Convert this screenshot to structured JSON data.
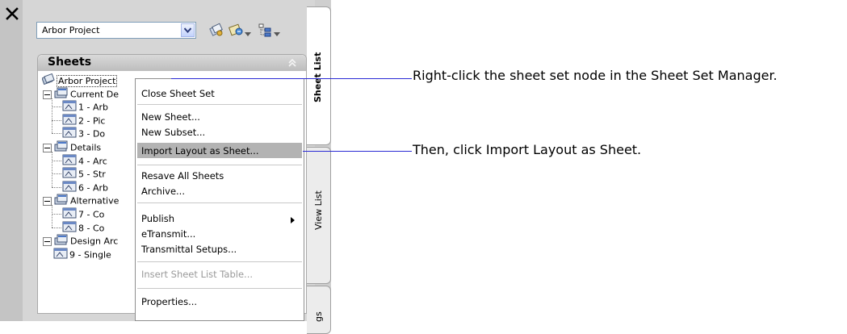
{
  "palette": {
    "close_icon": "close-icon",
    "project_selector": {
      "value": "Arbor Project"
    },
    "toolbar_icons": [
      "sheet-set-icon",
      "publish-icon",
      "view-options-icon"
    ]
  },
  "sheets_panel": {
    "title": "Sheets",
    "tree": [
      {
        "label": "Arbor Project",
        "level": 0,
        "type": "root"
      },
      {
        "label": "Current De",
        "level": 1,
        "type": "subset"
      },
      {
        "label": "1 - Arb",
        "level": 2,
        "type": "sheet"
      },
      {
        "label": "2 - Pic",
        "level": 2,
        "type": "sheet"
      },
      {
        "label": "3 - Do",
        "level": 2,
        "type": "sheet"
      },
      {
        "label": "Details",
        "level": 1,
        "type": "subset"
      },
      {
        "label": "4 - Arc",
        "level": 2,
        "type": "sheet"
      },
      {
        "label": "5 - Str",
        "level": 2,
        "type": "sheet"
      },
      {
        "label": "6 - Arb",
        "level": 2,
        "type": "sheet"
      },
      {
        "label": "Alternative",
        "level": 1,
        "type": "subset"
      },
      {
        "label": "7 - Co",
        "level": 2,
        "type": "sheet"
      },
      {
        "label": "8 - Co",
        "level": 2,
        "type": "sheet"
      },
      {
        "label": "Design Arc",
        "level": 1,
        "type": "subset"
      },
      {
        "label": "9 - Single",
        "level": 1,
        "type": "sheet"
      }
    ]
  },
  "context_menu": {
    "items": [
      {
        "label": "Close Sheet Set"
      },
      {
        "label": "New Sheet..."
      },
      {
        "label": "New Subset..."
      },
      {
        "label": "Import Layout as Sheet...",
        "highlighted": true
      },
      {
        "label": "Resave All Sheets"
      },
      {
        "label": "Archive..."
      },
      {
        "label": "Publish",
        "submenu": true
      },
      {
        "label": "eTransmit..."
      },
      {
        "label": "Transmittal Setups..."
      },
      {
        "label": "Insert Sheet List Table...",
        "disabled": true
      },
      {
        "label": "Properties..."
      }
    ]
  },
  "side_tabs": {
    "sheet_list": "Sheet List",
    "view_list": "View List",
    "resources_partial": "gs"
  },
  "callouts": {
    "first": "Right-click the sheet set node in the Sheet Set Manager.",
    "second": "Then, click Import Layout as Sheet."
  },
  "colors": {
    "callout_line": "#2a2ad4",
    "menu_highlight": "#b3b3b3",
    "panel_background": "#d6d6d6"
  }
}
